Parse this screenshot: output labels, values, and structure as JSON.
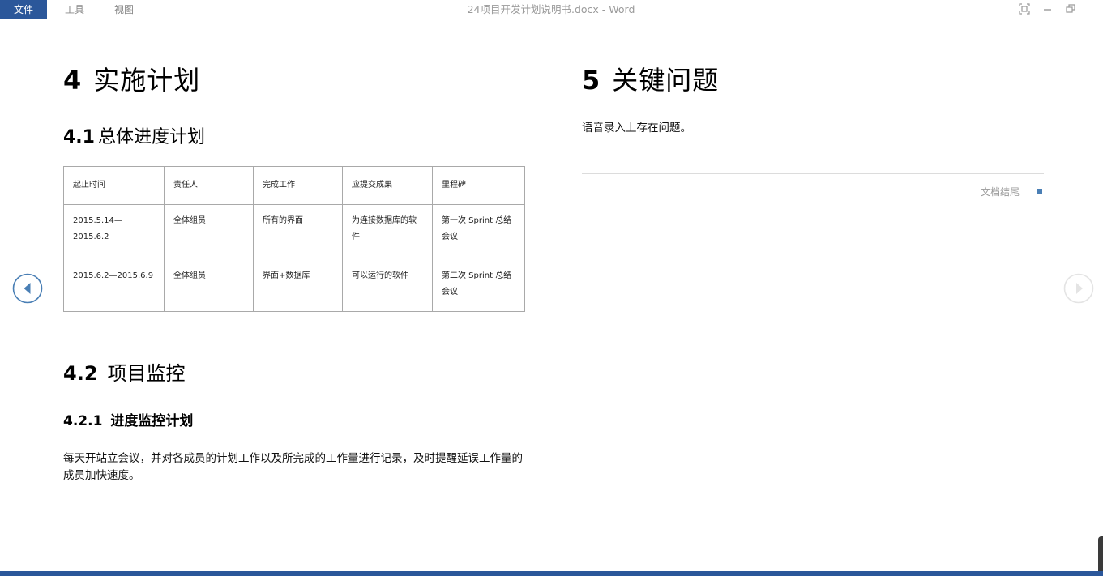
{
  "menu": {
    "file": "文件",
    "tools": "工具",
    "view": "视图"
  },
  "window": {
    "title": "24项目开发计划说明书.docx - Word"
  },
  "left_page": {
    "h1_num": "4",
    "h1_text": "实施计划",
    "h41_num": "4.1",
    "h41_text": "总体进度计划",
    "table": {
      "headers": [
        "起止时间",
        "责任人",
        "完成工作",
        "应提交成果",
        "里程碑"
      ],
      "rows": [
        [
          "2015.5.14—2015.6.2",
          "全体组员",
          "所有的界面",
          "为连接数据库的软件",
          "第一次 Sprint 总结会议"
        ],
        [
          "2015.6.2—2015.6.9",
          "全体组员",
          "界面+数据库",
          "可以运行的软件",
          "第二次 Sprint 总结会议"
        ]
      ]
    },
    "h42_num": "4.2",
    "h42_text": "项目监控",
    "h421_num": "4.2.1",
    "h421_text": "进度监控计划",
    "paragraph": "每天开站立会议，并对各成员的计划工作以及所完成的工作量进行记录，及时提醒延误工作量的成员加快速度。"
  },
  "right_page": {
    "h1_num": "5",
    "h1_text": "关键问题",
    "paragraph": "语音录入上存在问题。",
    "end_label": "文档结尾"
  },
  "icons": {
    "prev": "chevron-left-circle-icon",
    "next": "chevron-right-circle-icon",
    "restore": "restore-icon",
    "minimize": "minimize-icon",
    "fullscreen": "fullscreen-icon"
  },
  "colors": {
    "accent": "#2b579a",
    "end_marker": "#4a7fb5"
  }
}
